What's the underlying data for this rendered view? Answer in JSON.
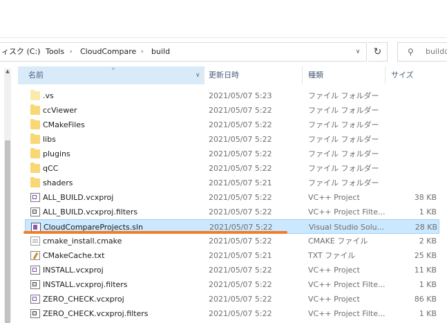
{
  "address": {
    "segments": [
      "ィスク (C:)",
      "Tools",
      "CloudCompare",
      "build"
    ],
    "separator": "›",
    "dropdown_icon": "chevron-down",
    "refresh_icon": "refresh"
  },
  "search": {
    "placeholder": "buildの",
    "icon": "search"
  },
  "columns": {
    "name": "名前",
    "date": "更新日時",
    "type": "種類",
    "size": "サイズ"
  },
  "files": [
    {
      "name": ".vs",
      "date": "2021/05/07 5:23",
      "type": "ファイル フォルダー",
      "size": "",
      "icon": "folder-hidden"
    },
    {
      "name": "ccViewer",
      "date": "2021/05/07 5:22",
      "type": "ファイル フォルダー",
      "size": "",
      "icon": "folder"
    },
    {
      "name": "CMakeFiles",
      "date": "2021/05/07 5:22",
      "type": "ファイル フォルダー",
      "size": "",
      "icon": "folder"
    },
    {
      "name": "libs",
      "date": "2021/05/07 5:22",
      "type": "ファイル フォルダー",
      "size": "",
      "icon": "folder"
    },
    {
      "name": "plugins",
      "date": "2021/05/07 5:22",
      "type": "ファイル フォルダー",
      "size": "",
      "icon": "folder"
    },
    {
      "name": "qCC",
      "date": "2021/05/07 5:22",
      "type": "ファイル フォルダー",
      "size": "",
      "icon": "folder"
    },
    {
      "name": "shaders",
      "date": "2021/05/07 5:21",
      "type": "ファイル フォルダー",
      "size": "",
      "icon": "folder"
    },
    {
      "name": "ALL_BUILD.vcxproj",
      "date": "2021/05/07 5:22",
      "type": "VC++ Project",
      "size": "38 KB",
      "icon": "vcxproj"
    },
    {
      "name": "ALL_BUILD.vcxproj.filters",
      "date": "2021/05/07 5:22",
      "type": "VC++ Project Filte...",
      "size": "1 KB",
      "icon": "vcxproj-filters"
    },
    {
      "name": "CloudCompareProjects.sln",
      "date": "2021/05/07 5:22",
      "type": "Visual Studio Solu...",
      "size": "28 KB",
      "icon": "sln"
    },
    {
      "name": "cmake_install.cmake",
      "date": "2021/05/07 5:22",
      "type": "CMAKE ファイル",
      "size": "2 KB",
      "icon": "document"
    },
    {
      "name": "CMakeCache.txt",
      "date": "2021/05/07 5:21",
      "type": "TXT ファイル",
      "size": "25 KB",
      "icon": "text"
    },
    {
      "name": "INSTALL.vcxproj",
      "date": "2021/05/07 5:22",
      "type": "VC++ Project",
      "size": "11 KB",
      "icon": "vcxproj"
    },
    {
      "name": "INSTALL.vcxproj.filters",
      "date": "2021/05/07 5:22",
      "type": "VC++ Project Filte...",
      "size": "1 KB",
      "icon": "vcxproj-filters"
    },
    {
      "name": "ZERO_CHECK.vcxproj",
      "date": "2021/05/07 5:22",
      "type": "VC++ Project",
      "size": "86 KB",
      "icon": "vcxproj"
    },
    {
      "name": "ZERO_CHECK.vcxproj.filters",
      "date": "2021/05/07 5:22",
      "type": "VC++ Project Filte...",
      "size": "1 KB",
      "icon": "vcxproj-filters"
    }
  ],
  "selected_file": "CloudCompareProjects.sln",
  "colors": {
    "selection": "#cce8ff",
    "selection_border": "#99d1ff",
    "highlight_underline": "#f07d29",
    "folder": "#f8d775"
  }
}
